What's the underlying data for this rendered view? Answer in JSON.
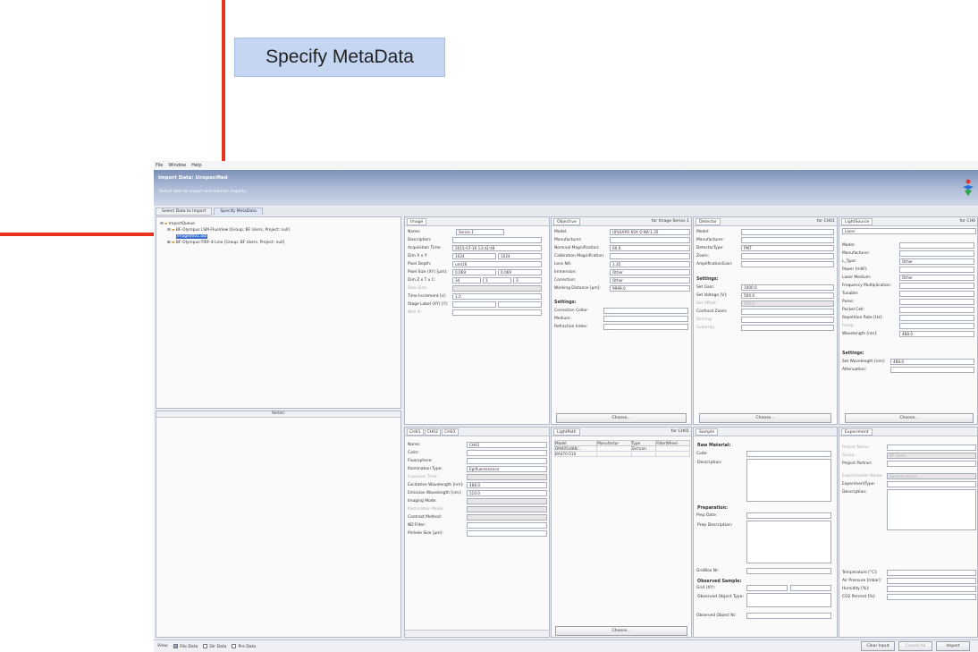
{
  "callout_label": "Specify MetaData",
  "menu": [
    "File",
    "Window",
    "Help"
  ],
  "banner": {
    "title": "Import Data: Unspecified",
    "subtitle": "Select data to import and monitor imports."
  },
  "tabs": [
    "Select Data to Import",
    "Specify MetaData"
  ],
  "tree": {
    "root": "ImportQueue",
    "items": [
      "BF-Olympus LSM-FluoView [Group: BF Users, Project: null]",
      "Image0001.oib",
      "BF-Olympus-TIRF-4-Line [Group: BF Users, Project: null]"
    ]
  },
  "series_label": "Series:",
  "image": {
    "tab": "Image",
    "fields": [
      {
        "label": "Name:",
        "value": "Series 1",
        "value2": ""
      },
      {
        "label": "Description:",
        "value": "",
        "value2": ""
      },
      {
        "label": "Acquisition Time:",
        "value": "2015-07-16 13:42:48",
        "value2": ""
      },
      {
        "label": "Dim X x Y:",
        "value": "1024",
        "value2": "1024"
      },
      {
        "label": "Pixel Depth:",
        "value": "uint16",
        "value2": ""
      },
      {
        "label": "Pixel Size (XY) [µm]:",
        "value": "0.069",
        "value2": "0.069"
      },
      {
        "label": "Dim Z x T x C:",
        "value": "34",
        "value2": "1",
        "value3": "3"
      },
      {
        "label": "Step Size:",
        "value": "",
        "value2": ""
      },
      {
        "label": "Time Increment [s]:",
        "value": "1.0",
        "value2": ""
      },
      {
        "label": "Stage Label (XY) [?]:",
        "value": "",
        "value2": ""
      },
      {
        "label": "Well #:",
        "value": "",
        "value2": ""
      }
    ]
  },
  "objective": {
    "tab": "Objective",
    "for": "for Image Series 1",
    "fields": [
      {
        "label": "Model:",
        "value": "UPLSAPO 60X O NA:1.35"
      },
      {
        "label": "Manufacturer:",
        "value": ""
      },
      {
        "label": "Nominal Magnification:",
        "value": "60.0"
      },
      {
        "label": "Calibration Magnification:",
        "value": ""
      },
      {
        "label": "Lens NA:",
        "value": "1.35"
      },
      {
        "label": "Immersion:",
        "value": "Other"
      },
      {
        "label": "Correction:",
        "value": "Other"
      },
      {
        "label": "Working Distance [µm]:",
        "value": "9999.0"
      }
    ],
    "settings_title": "Settings:",
    "settings": [
      {
        "label": "Correction Collar:",
        "value": ""
      },
      {
        "label": "Medium:",
        "value": ""
      },
      {
        "label": "Refraction Index:",
        "value": ""
      }
    ],
    "choose": "Choose..."
  },
  "detector": {
    "tab": "Detector",
    "for": "for CH01",
    "fields": [
      {
        "label": "Model:",
        "value": ""
      },
      {
        "label": "Manufacturer:",
        "value": ""
      },
      {
        "label": "DetectorType:",
        "value": "PMT"
      },
      {
        "label": "Zoom:",
        "value": ""
      },
      {
        "label": "AmplificationGain:",
        "value": ""
      }
    ],
    "settings_title": "Settings:",
    "settings": [
      {
        "label": "Set Gain:",
        "value": "1000.0"
      },
      {
        "label": "Set Voltage [V]:",
        "value": "500.0"
      },
      {
        "label": "Set Offset:",
        "value": "500.0"
      },
      {
        "label": "Confocal Zoom:",
        "value": ""
      },
      {
        "label": "Binning:",
        "value": ""
      },
      {
        "label": "Subarray:",
        "value": ""
      }
    ],
    "choose": "Choose..."
  },
  "lightsource": {
    "tab": "LightSource",
    "for": "for CH0",
    "type": "Laser",
    "fields": [
      {
        "label": "Model:",
        "value": ""
      },
      {
        "label": "Manufacturer:",
        "value": ""
      },
      {
        "label": "L_Type:",
        "value": "Other"
      },
      {
        "label": "Power [mW]:",
        "value": ""
      },
      {
        "label": "Laser Medium:",
        "value": "Other"
      },
      {
        "label": "Frequency Multiplication:",
        "value": ""
      },
      {
        "label": "Tunable:",
        "value": ""
      },
      {
        "label": "Pulse:",
        "value": ""
      },
      {
        "label": "Pockel Cell:",
        "value": ""
      },
      {
        "label": "Repetition Rate [Hz]:",
        "value": ""
      },
      {
        "label": "Pump:",
        "value": ""
      },
      {
        "label": "Wavelength [nm]:",
        "value": "488.0"
      }
    ],
    "settings_title": "Settings:",
    "settings": [
      {
        "label": "Set Wavelength [nm]:",
        "value": "488.0"
      },
      {
        "label": "Attenuation:",
        "value": ""
      }
    ],
    "choose": "Choose..."
  },
  "channel": {
    "tabs": [
      "CH01",
      "CH02",
      "CH03"
    ],
    "fields": [
      {
        "label": "Name:",
        "value": "CH01"
      },
      {
        "label": "Color:",
        "value": ""
      },
      {
        "label": "Fluorophore:",
        "value": ""
      },
      {
        "label": "Illumination Type:",
        "value": "Epifluorescence"
      },
      {
        "label": "Exposure Time:",
        "value": ""
      },
      {
        "label": "Excitation Wavelength [nm]:",
        "value": "488.0"
      },
      {
        "label": "Emission Wavelength [nm]:",
        "value": "510.0"
      },
      {
        "label": "Imaging Mode:",
        "value": ""
      },
      {
        "label": "Illumination Mode:",
        "value": ""
      },
      {
        "label": "Contrast Method:",
        "value": ""
      },
      {
        "label": "ND Filter:",
        "value": ""
      },
      {
        "label": "Pinhole Size [µm]:",
        "value": ""
      }
    ]
  },
  "lightpath": {
    "tab": "LightPath",
    "for": "for CH01",
    "headers": [
      "Model",
      "Manufactur",
      "Type",
      "FilterWheel"
    ],
    "rows": [
      [
        "DM405/488/...",
        "",
        "Dichroic",
        ""
      ],
      [
        "BA470-510",
        "",
        "",
        ""
      ]
    ],
    "choose": "Choose..."
  },
  "sample": {
    "tab": "Sample",
    "raw_title": "Raw Material:",
    "code_label": "Code:",
    "desc_label": "Description:",
    "prep_title": "Preparation:",
    "prep_date_label": "Prep Date:",
    "prep_desc_label": "Prep Description:",
    "gridbox_label": "GridBox Nr:",
    "obs_title": "Observed Sample:",
    "grid_label": "Grid (XY):",
    "obs_type_label": "Observed Object Type:",
    "obs_nr_label": "Observed Object Nr:"
  },
  "experiment": {
    "tab": "Experiment",
    "fields": [
      {
        "label": "Project Name:",
        "value": ""
      },
      {
        "label": "Group:",
        "value": "BF Users"
      },
      {
        "label": "Project Partner:",
        "value": ""
      },
      {
        "label": "Experimenter Name:",
        "value": "Susanne Kunis"
      },
      {
        "label": "ExperimentType:",
        "value": ""
      },
      {
        "label": "Description:",
        "value": ""
      }
    ],
    "env": [
      {
        "label": "Temperature [°C]:",
        "value": ""
      },
      {
        "label": "Air Pressure [mbar]:",
        "value": ""
      },
      {
        "label": "Humidity [%]:",
        "value": ""
      },
      {
        "label": "CO2 Percent [%]:",
        "value": ""
      }
    ]
  },
  "statusbar": {
    "view_label": "View:",
    "checks": [
      {
        "label": "File Data",
        "checked": true
      },
      {
        "label": "Dir Data",
        "checked": false
      },
      {
        "label": "Pre Data",
        "checked": false
      }
    ],
    "buttons": [
      "Clear Input",
      "Cancel All",
      "Import"
    ]
  },
  "colors": {
    "arrow": "#e8331c",
    "banner": "#8b9ec2",
    "selection": "#3b6fd0",
    "callout": "#c5d6f3"
  }
}
